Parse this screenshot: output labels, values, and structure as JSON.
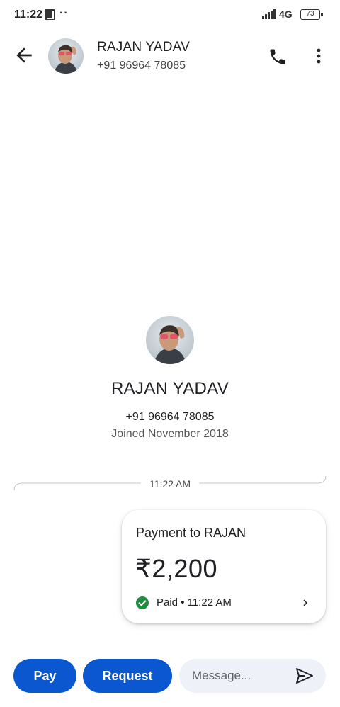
{
  "status_bar": {
    "time": "11:22",
    "dots": "··",
    "network": "4G",
    "battery": "73"
  },
  "header": {
    "contact_name": "RAJAN YADAV",
    "contact_phone": "+91 96964 78085"
  },
  "profile": {
    "name": "RAJAN YADAV",
    "phone": "+91 96964 78085",
    "joined": "Joined November 2018"
  },
  "timeline": {
    "timestamp": "11:22 AM"
  },
  "payment_card": {
    "title": "Payment to RAJAN",
    "amount": "₹2,200",
    "status": "Paid • 11:22 AM"
  },
  "bottom_bar": {
    "pay_label": "Pay",
    "request_label": "Request",
    "message_placeholder": "Message..."
  },
  "colors": {
    "primary_button": "#0b57d0",
    "paid_green": "#1e8e3e",
    "message_box": "#eef2f8"
  },
  "icons": {
    "back": "arrow-left-icon",
    "call": "phone-icon",
    "more": "more-vert-icon",
    "paid": "check-circle-icon",
    "chevron": "chevron-right-icon",
    "send": "send-icon"
  }
}
